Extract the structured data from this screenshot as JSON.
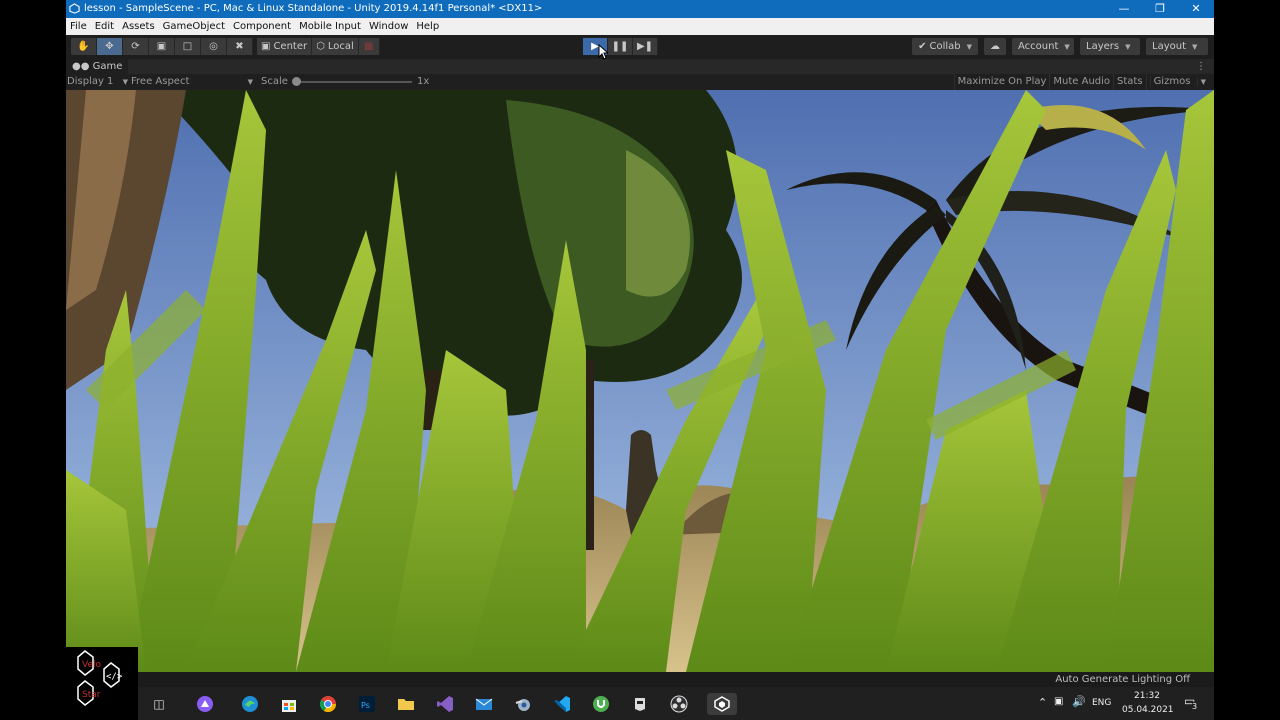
{
  "window": {
    "title": "lesson - SampleScene - PC, Mac & Linux Standalone - Unity 2019.4.14f1 Personal* <DX11>"
  },
  "menu": [
    "File",
    "Edit",
    "Assets",
    "GameObject",
    "Component",
    "Mobile Input",
    "Window",
    "Help"
  ],
  "toolbar": {
    "pivot_label": "Center",
    "space_label": "Local",
    "collab_label": "Collab",
    "account_label": "Account",
    "layers_label": "Layers",
    "layout_label": "Layout"
  },
  "game_tab": {
    "label": "Game",
    "display": "Display 1",
    "aspect": "Free Aspect",
    "scale_label": "Scale",
    "scale_value": "1x",
    "maximize_label": "Maximize On Play",
    "mute_label": "Mute Audio",
    "stats_label": "Stats",
    "gizmos_label": "Gizmos"
  },
  "status": {
    "lighting": "Auto Generate Lighting Off"
  },
  "tray": {
    "language": "ENG",
    "time": "21:32",
    "date": "05.04.2021",
    "notifications": "3"
  },
  "logo": {
    "line1": "Velo",
    "line2": "Star"
  },
  "colors": {
    "title_bar": "#0f6cbd",
    "toolbar": "#1e1e1e",
    "play_active": "#3c6aa8",
    "sky": "#6b8cc4",
    "grass": "#7fa82a"
  }
}
